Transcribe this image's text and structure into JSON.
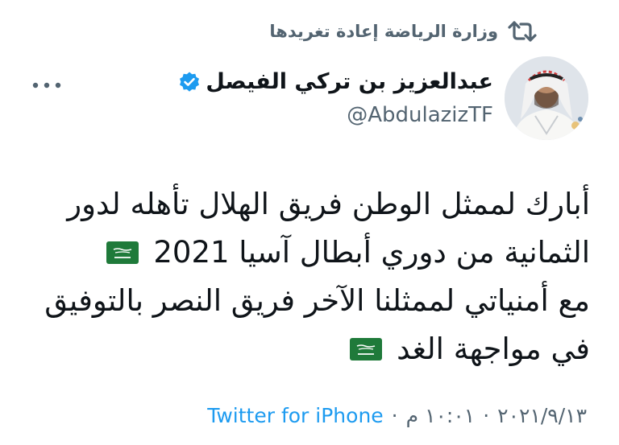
{
  "retweet": {
    "label": "وزارة الرياضة إعادة تغريدها",
    "icon": "retweet-icon"
  },
  "author": {
    "display_name": "عبدالعزيز بن تركي الفيصل",
    "handle": "@AbdulazizTF",
    "verified": true,
    "verified_color": "#1d9bf0"
  },
  "tweet": {
    "lines": [
      "أبارك لممثل الوطن فريق الهلال تأهله لدور",
      "الثمانية من دوري أبطال آسيا 2021",
      "مع أمنياتي لممثلنا الآخر فريق النصر بالتوفيق",
      "في مواجهة الغد"
    ],
    "flag_emoji": "saudi-flag-icon"
  },
  "meta": {
    "time": "١٠:٠١ م",
    "date": "٢٠٢١/٩/١٣",
    "separator": "·",
    "source": "Twitter for iPhone"
  },
  "colors": {
    "text": "#0f1419",
    "secondary": "#536471",
    "link": "#1d9bf0",
    "flag_green": "#1f7a3a"
  }
}
